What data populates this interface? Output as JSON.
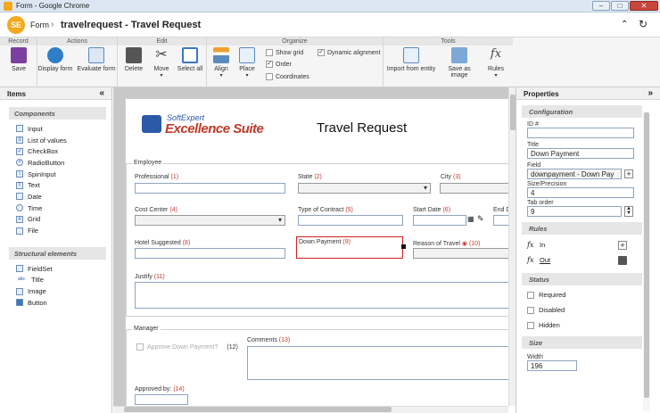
{
  "window": {
    "title": "Form - Google Chrome",
    "minimize": "–",
    "maximize": "□",
    "close": "✕"
  },
  "header": {
    "logo": "SE",
    "home": "Form",
    "separator": "›",
    "page_title": "travelrequest - Travel Request"
  },
  "ribbon": {
    "groups": [
      "Record",
      "Actions",
      "Edit",
      "Organize",
      "Tools"
    ],
    "save": "Save",
    "display_form": "Display form",
    "evaluate_form": "Evaluate form",
    "delete": "Delete",
    "move": "Move",
    "select_all": "Select all",
    "align": "Align",
    "place": "Place",
    "show_grid": "Show grid",
    "order": "Order",
    "coordinates": "Coordinates",
    "dynamic_alignment": "Dynamic alignment",
    "import_from_entity": "Import from entity",
    "save_as_image": "Save as image",
    "rules": "Rules"
  },
  "items_panel": {
    "title": "Items",
    "collapse": "«",
    "components_title": "Components",
    "components": [
      "Input",
      "List of values",
      "CheckBox",
      "RadioButton",
      "SpinInput",
      "Text",
      "Date",
      "Time",
      "Grid",
      "File"
    ],
    "structural_title": "Structural elements",
    "structural": [
      "FieldSet",
      "Title",
      "Image",
      "Button"
    ]
  },
  "form": {
    "logo_top": "SoftExpert",
    "logo_main": "Excellence Suite",
    "title": "Travel Request",
    "employee_legend": "Employee",
    "professional": "Professional",
    "professional_n": "(1)",
    "state": "State",
    "state_n": "(2)",
    "city": "City",
    "city_n": "(3)",
    "cost_center": "Cost Center",
    "cost_center_n": "(4)",
    "type_contract": "Type of Contract",
    "type_contract_n": "(5)",
    "start_date": "Start Date",
    "start_date_n": "(6)",
    "end_date": "End D",
    "hotel": "Hotel Suggested",
    "hotel_n": "(8)",
    "down_payment": "Down Payment",
    "down_payment_n": "(9)",
    "reason": "Reason of Travel",
    "reason_n": "(10)",
    "justify": "Justify",
    "justify_n": "(11)",
    "manager_legend": "Manager",
    "approve": "Approve Down Payment?",
    "approve_n": "(12)",
    "comments": "Comments",
    "comments_n": "(13)",
    "approved_by": "Approved by:",
    "approved_by_n": "(14)"
  },
  "properties": {
    "title": "Properties",
    "expand": "»",
    "configuration": "Configuration",
    "id_label": "ID #",
    "id_value": "",
    "title_label": "Title",
    "title_value": "Down Payment",
    "field_label": "Field",
    "field_value": "downpayment - Down Pay",
    "size_label": "Size/Precision",
    "size_value": "4",
    "tab_label": "Tab order",
    "tab_value": "9",
    "rules": "Rules",
    "rule_in": "In",
    "rule_out": "Out",
    "status": "Status",
    "required": "Required",
    "disabled": "Disabled",
    "hidden": "Hidden",
    "size": "Size",
    "width_label": "Width",
    "width_value": "196"
  }
}
